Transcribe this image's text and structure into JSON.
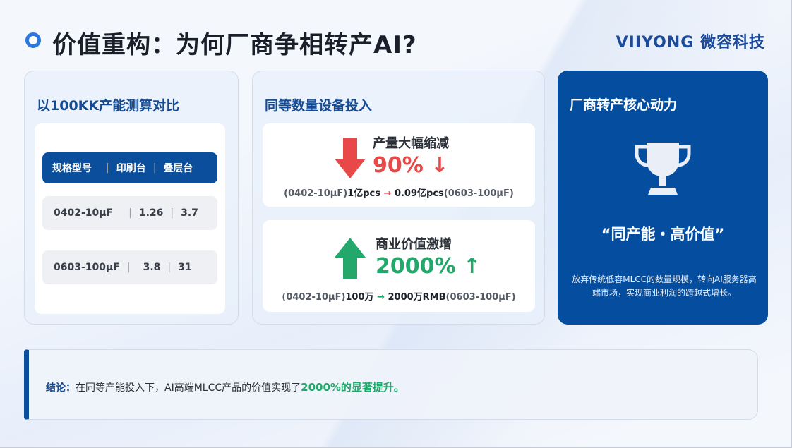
{
  "header": {
    "title": "价值重构：为何厂商争相转产AI?",
    "brand": "VIIYONG 微容科技"
  },
  "card1": {
    "title": "以100KK产能测算对比",
    "table": {
      "headers": [
        "规格型号",
        "印刷台",
        "叠层台"
      ],
      "rows": [
        [
          "0402-10μF",
          "1.26",
          "3.7"
        ],
        [
          "0603-100μF",
          "3.8",
          "31"
        ]
      ]
    }
  },
  "card2": {
    "title": "同等数量设备投入",
    "decrease": {
      "icon": "down-arrow-icon",
      "color": "#e84848",
      "label": "产量大幅缩减",
      "value": "90% ↓",
      "from_spec": "(0402-10μF)",
      "from_value": "1亿pcs",
      "arrow": "→",
      "to_value": "0.09亿pcs",
      "to_spec": "(0603-100μF)"
    },
    "increase": {
      "icon": "up-arrow-icon",
      "color": "#21a86a",
      "label": "商业价值激增",
      "value": "2000% ↑",
      "from_spec": "(0402-10μF)",
      "from_value": "100万",
      "arrow": "→",
      "to_value": "2000万RMB",
      "to_spec": "(0603-100μF)"
    }
  },
  "card3": {
    "title": "厂商转产核心动力",
    "icon": "trophy-icon",
    "slogan": "“同产能・高价值”",
    "description": "放弃传统低容MLCC的数量规模，转向AI服务器高端市场，实现商业利润的跨越式增长。"
  },
  "conclusion": {
    "prefix": "结论：",
    "text": "在同等产能投入下，AI高端MLCC产品的价值实现了",
    "highlight": "2000%的显著提升。"
  },
  "colors": {
    "primary": "#0a4e9c",
    "accent": "#2a78e0",
    "red": "#e84848",
    "green": "#21a86a"
  }
}
